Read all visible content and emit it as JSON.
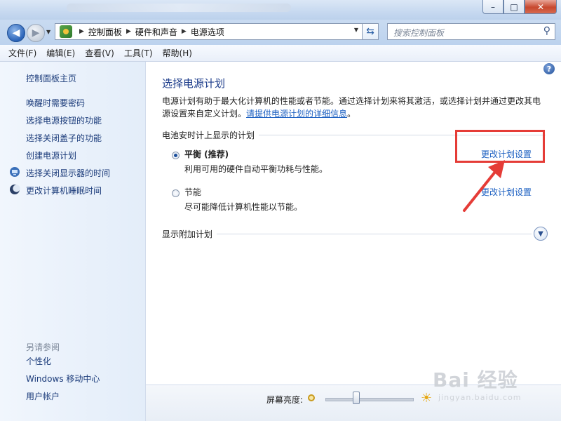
{
  "window": {
    "minimize_glyph": "–",
    "maximize_glyph": "□",
    "close_glyph": "✕"
  },
  "address": {
    "crumbs": [
      "控制面板",
      "硬件和声音",
      "电源选项"
    ],
    "search_placeholder": "搜索控制面板"
  },
  "menu": [
    "文件(F)",
    "编辑(E)",
    "查看(V)",
    "工具(T)",
    "帮助(H)"
  ],
  "sidebar": {
    "home": "控制面板主页",
    "links": [
      "唤醒时需要密码",
      "选择电源按钮的功能",
      "选择关闭盖子的功能",
      "创建电源计划",
      "选择关闭显示器的时间",
      "更改计算机睡眠时间"
    ],
    "see_also": "另请参阅",
    "see_also_links": [
      "个性化",
      "Windows 移动中心",
      "用户帐户"
    ]
  },
  "main": {
    "title": "选择电源计划",
    "desc_text": "电源计划有助于最大化计算机的性能或者节能。通过选择计划来将其激活，或选择计划并通过更改其电源设置来自定义计划。",
    "desc_link": "请提供电源计划的详细信息",
    "desc_end": "。",
    "section_title": "电池安时计上显示的计划",
    "plans": [
      {
        "name": "平衡 (推荐)",
        "desc": "利用可用的硬件自动平衡功耗与性能。",
        "selected": true,
        "link": "更改计划设置"
      },
      {
        "name": "节能",
        "desc": "尽可能降低计算机性能以节能。",
        "selected": false,
        "link": "更改计划设置"
      }
    ],
    "extra_plans": "显示附加计划"
  },
  "bottom": {
    "brightness_label": "屏幕亮度:",
    "brightness_level": 0.35
  },
  "watermark": {
    "main": "Bai 经验",
    "sub": "jingyan.baidu.com"
  },
  "colors": {
    "link": "#1b5fc1",
    "annotation_red": "#e53c37"
  },
  "icons": {
    "back": "back-arrow-icon",
    "forward": "forward-arrow-icon",
    "refresh": "refresh-icon",
    "search": "search-icon",
    "help": "help-icon",
    "expand": "chevron-down-icon"
  }
}
